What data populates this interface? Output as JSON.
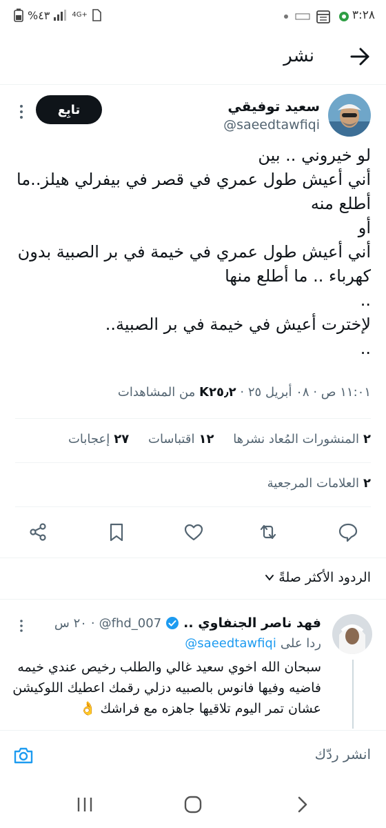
{
  "status_bar": {
    "time": "٣:٢٨",
    "battery": "%٤٣",
    "network": "4G+"
  },
  "header": {
    "title": "نشر"
  },
  "tweet": {
    "author_name": "سعيد توفيقي",
    "author_handle": "@saeedtawfiqi",
    "follow_label": "تابِع",
    "text": "لو خيروني .. بين\nأني أعيش طول عمري في قصر في بيفرلي هيلز..ما أطلع منه\nأو\nأني أعيش طول عمري في خيمة في بر الصبية بدون كهرباء .. ما أطلع منها\n..\nلإخترت أعيش في خيمة في بر الصبية..\n..",
    "timestamp": "١١:٠١ ص · ٠٨ أبريل ٢٥",
    "views_count": "K٢٥٫٢",
    "views_label": "من المشاهدات",
    "separator": "·"
  },
  "stats": {
    "reposts_count": "٢",
    "reposts_label": "المنشورات المُعاد نشرها",
    "quotes_count": "١٢",
    "quotes_label": "اقتباسات",
    "likes_count": "٢٧",
    "likes_label": "إعجابات",
    "bookmarks_count": "٢",
    "bookmarks_label": "العلامات المرجعية"
  },
  "actions": [
    "reply-icon",
    "retweet-icon",
    "like-icon",
    "bookmark-icon",
    "share-icon"
  ],
  "replies": {
    "sort_label": "الردود الأكثر صلةً",
    "items": [
      {
        "name": "فهد ناصر الجنفاوي ..",
        "handle": "@fhd_007",
        "time": "٢٠ س",
        "replying_to_label": "ردا على",
        "replying_to_handle": "@saeedtawfiqi",
        "text": "سبحان الله اخوي سعيد غالي والطلب رخيص عندي خيمه فاضيه وفيها فانوس بالصبيه دزلي رقمك اعطيك اللوكيشن عشان تمر اليوم تلاقيها جاهزه مع فراشك 👌"
      }
    ]
  },
  "compose": {
    "placeholder": "انشر ردّك"
  },
  "colors": {
    "verified_badge": "#1d9bf0",
    "secondary_text": "#536471",
    "primary_text": "#0f1419",
    "follow_button_bg": "#0f1419"
  }
}
